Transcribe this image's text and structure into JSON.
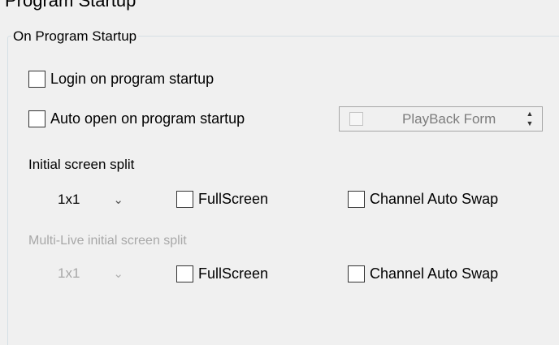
{
  "header": {
    "fragment": "Program Startup"
  },
  "group": {
    "title": "On Program Startup"
  },
  "options": {
    "login_label": "Login on program startup",
    "auto_open_label": "Auto open on program startup"
  },
  "form_picker": {
    "value": "PlayBack Form",
    "checked": false,
    "enabled": false
  },
  "initial_split": {
    "heading": "Initial screen split",
    "combo_value": "1x1",
    "fullscreen_label": "FullScreen",
    "auto_swap_label": "Channel Auto Swap",
    "enabled": true
  },
  "multilive_split": {
    "heading": "Multi-Live initial screen split",
    "combo_value": "1x1",
    "fullscreen_label": "FullScreen",
    "auto_swap_label": "Channel Auto Swap",
    "enabled": false
  },
  "icons": {
    "combo_arrow": "chevron-down-icon",
    "spin_arrows": "spin-updown-icon"
  }
}
